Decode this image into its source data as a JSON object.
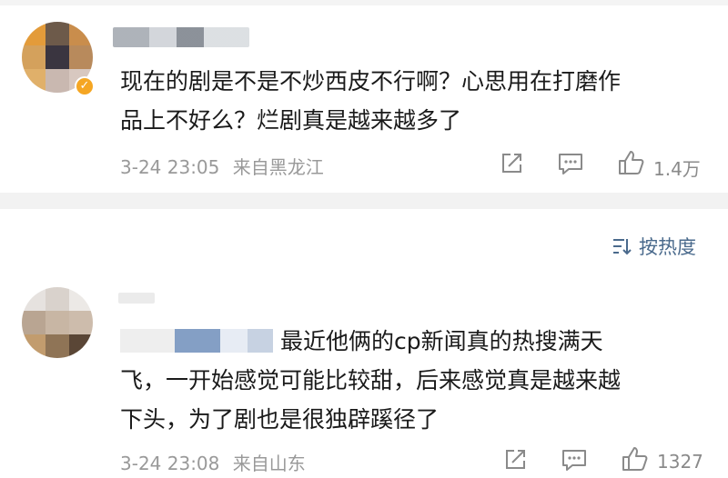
{
  "comments": [
    {
      "text_line1": "现在的剧是不是不炒西皮不行啊？心思用在打磨作",
      "text_line2": "品上不好么？烂剧真是越来越多了",
      "time": "3-24 23:05",
      "location": "来自黑龙江",
      "likes": "1.4万",
      "verified": true,
      "badge_icon": "verified-check-icon"
    },
    {
      "text_line1": "最近他俩的cp新闻真的热搜满天",
      "text_line2": "飞，一开始感觉可能比较甜，后来感觉真是越来越",
      "text_line3": "下头，为了剧也是很独辟蹊径了",
      "time": "3-24 23:08",
      "location": "来自山东",
      "likes": "1327",
      "verified": false
    }
  ],
  "sort": {
    "label": "按热度",
    "icon": "sort-icon"
  },
  "colors": {
    "link": "#4a6a8c",
    "meta": "#999999",
    "badge": "#f5a623",
    "divider": "#f2f2f2"
  }
}
